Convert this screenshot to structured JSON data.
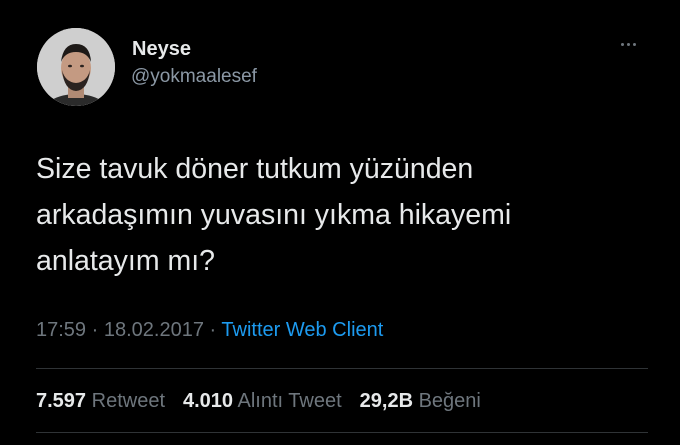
{
  "user": {
    "display_name": "Neyse",
    "handle": "@yokmaalesef",
    "avatar": "profile-photo"
  },
  "tweet": {
    "lines": [
      "Size tavuk döner tutkum yüzünden",
      "arkadaşımın yuvasını yıkma hikayemi",
      "anlatayım mı?"
    ]
  },
  "meta": {
    "time": "17:59",
    "separator1": "·",
    "date": "18.02.2017",
    "separator2": "·",
    "source": "Twitter Web Client"
  },
  "stats": {
    "retweets": {
      "count": "7.597",
      "label": "Retweet"
    },
    "quotes": {
      "count": "4.010",
      "label": "Alıntı Tweet"
    },
    "likes": {
      "count": "29,2B",
      "label": "Beğeni"
    }
  },
  "colors": {
    "background": "#000000",
    "text": "#e7e9ea",
    "muted": "#6e767d",
    "link": "#1d9bf0"
  }
}
